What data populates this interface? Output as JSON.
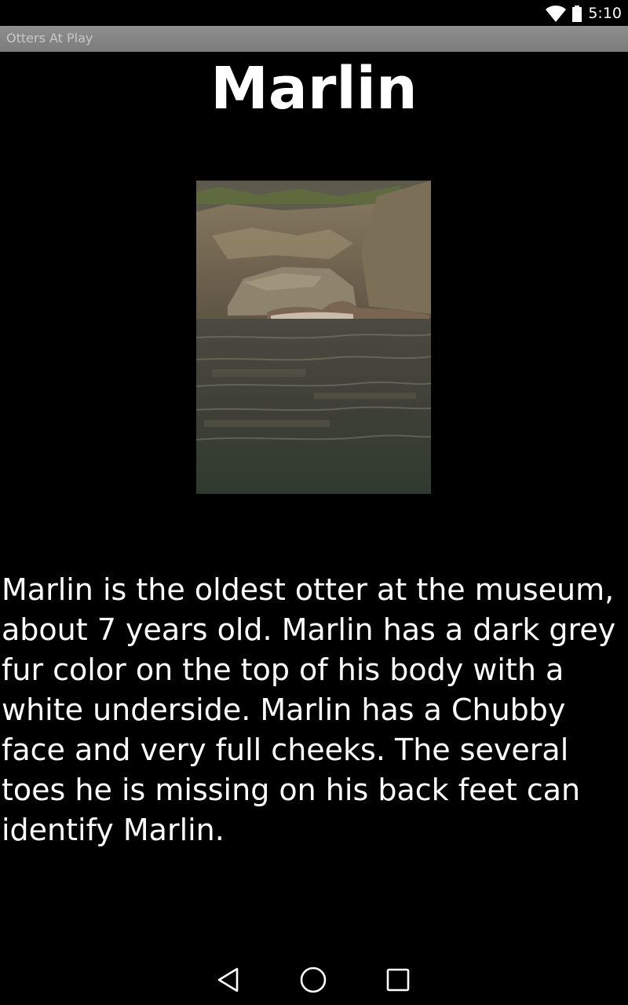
{
  "status_bar": {
    "time": "5:10",
    "icons": [
      "wifi-icon",
      "battery-icon"
    ]
  },
  "app_bar": {
    "title": "Otters At Play"
  },
  "otter": {
    "name": "Marlin",
    "photo_icon": "otter-photo",
    "description": "Marlin is the oldest otter at the museum, about 7 years old. Marlin has a dark grey fur color on the top of his body with a white underside. Marlin has a Chubby face and very full cheeks. The several toes he is missing on his back feet can identify Marlin."
  },
  "navigation": {
    "icons": [
      "back-icon",
      "home-icon",
      "recent-apps-icon"
    ]
  },
  "colors": {
    "background": "#000000",
    "title_bar": "#858585",
    "text": "#ffffff"
  }
}
